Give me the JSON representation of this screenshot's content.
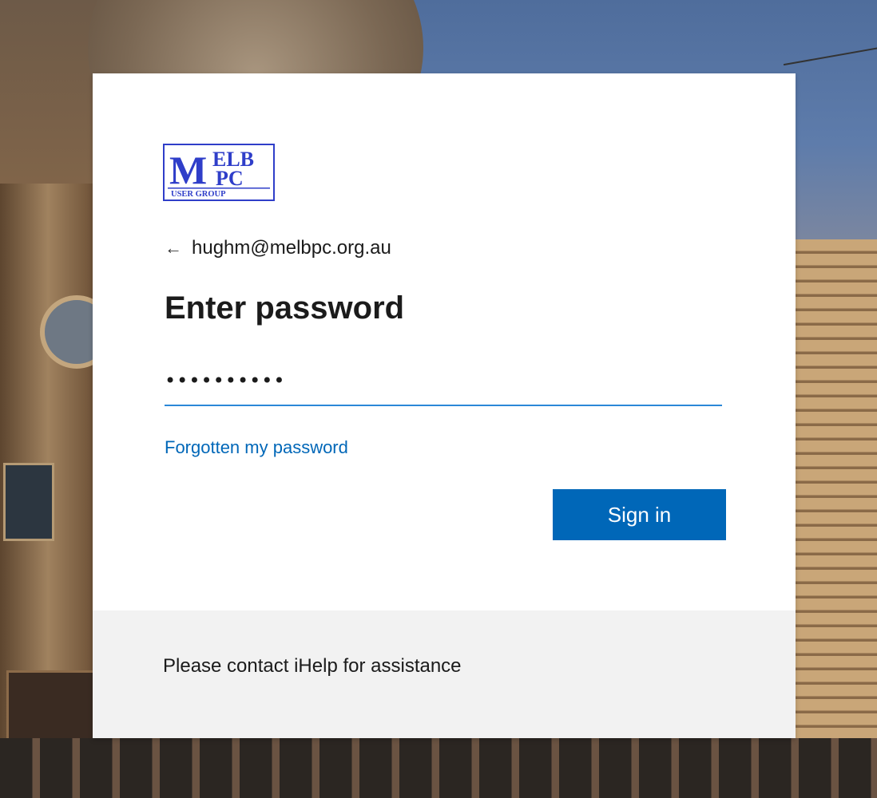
{
  "signin": {
    "logo_text": {
      "line1_big": "M",
      "line1_top": "ELB",
      "line1_bottom": "PC",
      "line2": "USER GROUP"
    },
    "identity": "hughm@melbpc.org.au",
    "title": "Enter password",
    "password_value": "••••••••••",
    "forgot_link": "Forgotten my password",
    "signin_button": "Sign in",
    "footer_text": "Please contact iHelp for assistance"
  },
  "colors": {
    "accent": "#0067b8",
    "input_underline": "#2b88d8",
    "logo_blue": "#2f3ec9",
    "footer_bg": "#f2f2f2"
  }
}
